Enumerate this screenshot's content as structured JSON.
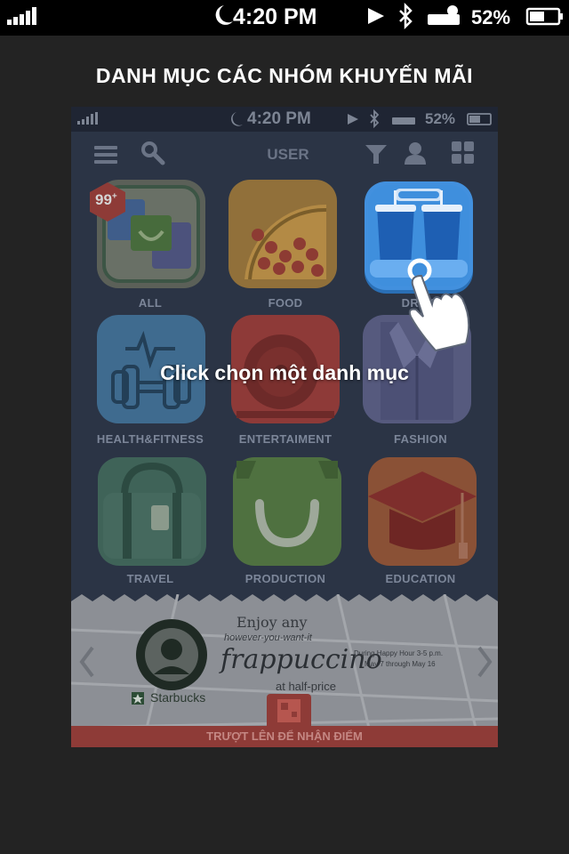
{
  "device_status": {
    "time": "4:20 PM",
    "battery": "52%"
  },
  "page_title": "DANH MỤC CÁC NHÓM KHUYẾN MÃI",
  "app_status": {
    "time": "4:20 PM",
    "battery": "52%"
  },
  "toolbar": {
    "title": "USER"
  },
  "categories": [
    {
      "label": "ALL",
      "badge": "99",
      "badge_suffix": "+"
    },
    {
      "label": "FOOD"
    },
    {
      "label": "DRINK"
    },
    {
      "label": "HEALTH&FITNESS"
    },
    {
      "label": "ENTERTAIMENT"
    },
    {
      "label": "FASHION"
    },
    {
      "label": "TRAVEL"
    },
    {
      "label": "PRODUCTION"
    },
    {
      "label": "EDUCATION"
    }
  ],
  "hint": "Click chọn một danh mục",
  "banner": {
    "brand": "Starbucks",
    "line1": "Enjoy any",
    "line2": "however-you-want-it",
    "product": "frappuccino",
    "line4": "at half-price",
    "promo1": "During Happy Hour 3-5 p.m.",
    "promo2": "May 7 through May 16"
  },
  "footer": "TRƯỢT LÊN ĐỂ NHẬN ĐIỂM",
  "colors": {
    "accent_blue": "#3f8fdd",
    "footer_red": "#8e3b37"
  }
}
